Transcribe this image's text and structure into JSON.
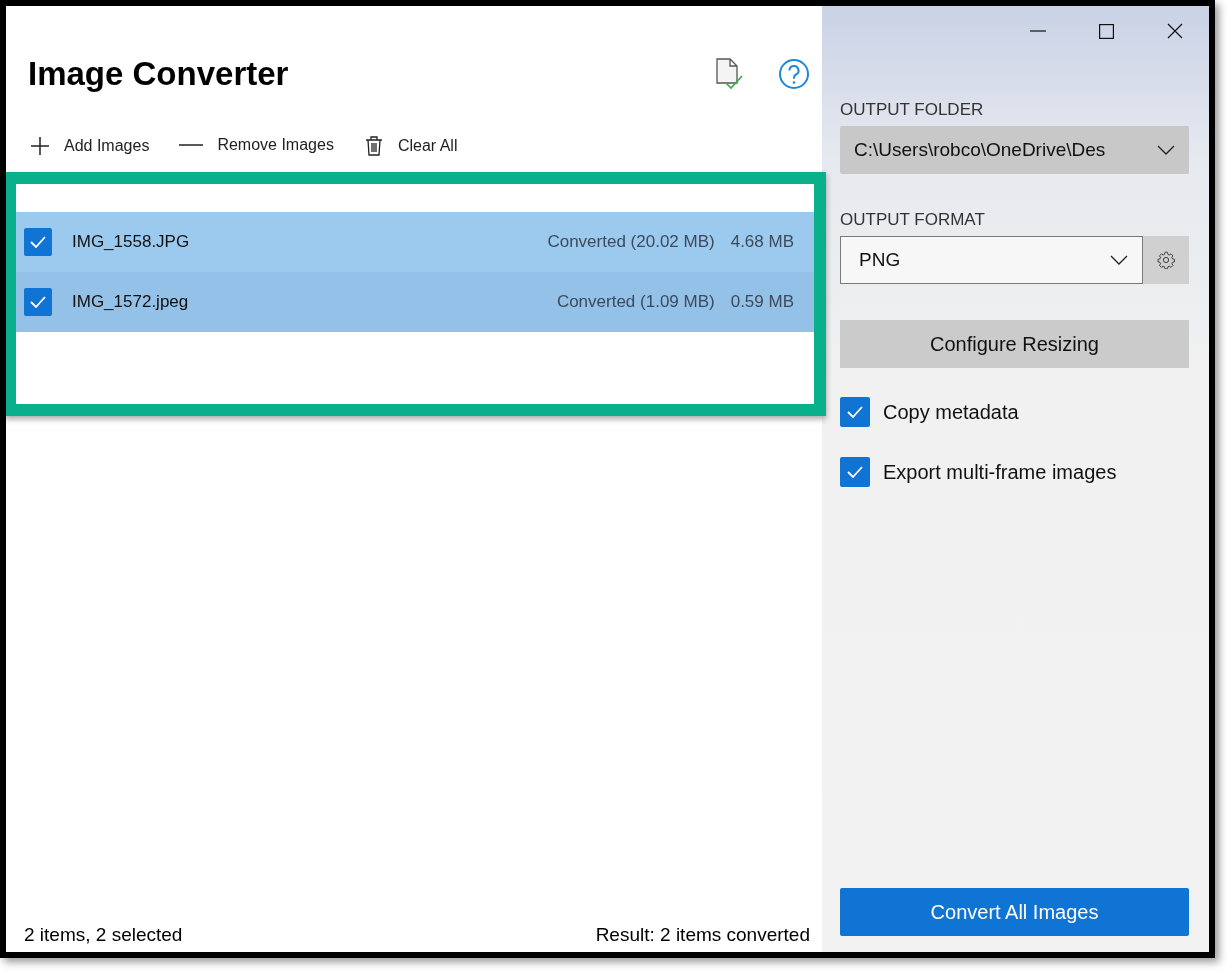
{
  "window": {
    "title": "Image Converter"
  },
  "toolbar": [
    {
      "label": "Add Images",
      "kind": "add"
    },
    {
      "label": "Remove Images",
      "kind": "remove"
    },
    {
      "label": "Clear All",
      "kind": "clear"
    }
  ],
  "files": [
    {
      "name": "IMG_1558.JPG",
      "status": "Converted (20.02 MB)",
      "size": "4.68 MB",
      "checked": true,
      "selected": true
    },
    {
      "name": "IMG_1572.jpeg",
      "status": "Converted (1.09 MB)",
      "size": "0.59 MB",
      "checked": true,
      "selected": true
    }
  ],
  "status_bar": {
    "count": "2 items, 2 selected",
    "result": "Result: 2 items converted"
  },
  "settings": {
    "output_folder": {
      "label": "OUTPUT FOLDER",
      "value": "C:\\Users\\robco\\OneDrive\\Des"
    },
    "output_format": {
      "label": "OUTPUT FORMAT",
      "value": "PNG"
    },
    "resize_button": "Configure Resizing",
    "options": [
      {
        "label": "Copy metadata",
        "checked": true
      },
      {
        "label": "Export multi-frame images",
        "checked": true
      }
    ],
    "convert_button": "Convert All Images"
  }
}
